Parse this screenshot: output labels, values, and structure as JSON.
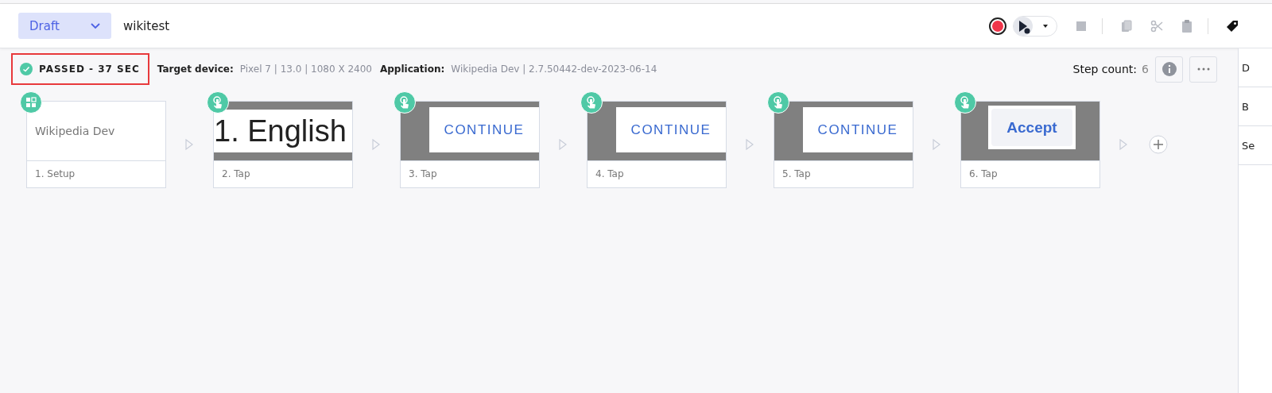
{
  "header": {
    "status_dropdown": "Draft",
    "test_name": "wikitest"
  },
  "toolbar": {
    "record": true,
    "stop_disabled": true
  },
  "run_info": {
    "result": {
      "text": "PASSED - 37 SEC",
      "passed": true,
      "highlighted": true
    },
    "target_device_label": "Target device:",
    "target_device": "Pixel 7 | 13.0 | 1080 X 2400",
    "application_label": "Application:",
    "application": "Wikipedia Dev | 2.7.50442-dev-2023-06-14",
    "step_count_label": "Step count:",
    "step_count": "6"
  },
  "steps": [
    {
      "kind": "setup",
      "preview": "Wikipedia Dev",
      "label": "1. Setup"
    },
    {
      "kind": "banner",
      "preview": "1.   English",
      "label": "2. Tap"
    },
    {
      "kind": "dialog",
      "preview": "CONTINUE",
      "label": "3. Tap"
    },
    {
      "kind": "dialog",
      "preview": "CONTINUE",
      "label": "4. Tap"
    },
    {
      "kind": "dialog",
      "preview": "CONTINUE",
      "label": "5. Tap"
    },
    {
      "kind": "button",
      "preview": "Accept",
      "label": "6. Tap"
    }
  ],
  "side_panel": {
    "tabs": [
      "D",
      "B",
      "Se"
    ]
  }
}
